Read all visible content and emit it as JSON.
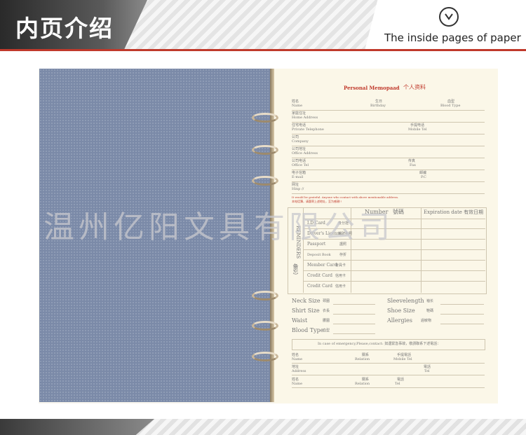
{
  "header": {
    "title_cn": "内页介绍",
    "title_en": "The inside pages of paper",
    "icon": "chevron-down-circle-icon"
  },
  "page": {
    "heading_en": "Personal Memopaad",
    "heading_cn": "个人资料",
    "row1": {
      "name_cn": "姓名",
      "name": "Name",
      "birthday_cn": "生日",
      "birthday": "Birthday",
      "blood_cn": "血型",
      "blood": "Blood Type"
    },
    "home_cn": "家庭住址",
    "home": "Home Address",
    "tel_cn": "住宅电话",
    "tel": "Private Telephone",
    "mobile_cn": "手提电话",
    "mobile": "Mobile Tel",
    "company_cn": "公司",
    "company": "Company",
    "office_addr_cn": "公司地址",
    "office_addr": "Office Address",
    "office_tel_cn": "公司电话",
    "office_tel": "Office Tel",
    "fax_cn": "传真",
    "fax": "Fax",
    "email_cn": "电子信箱",
    "email": "E-mail",
    "pc_cn": "邮编",
    "pc": "P.C",
    "hinp_cn": "网址",
    "hinp": "Hinp //",
    "notice_en": "It would be grateful. Anyone who contact with above mentionable address.",
    "notice_cn": "本电话簿，请惠寄上述地址，至为感谢!!",
    "reminders": {
      "number_header": "Number",
      "number_cn": "號碼",
      "expiration_header": "Expiration date 有效日期",
      "side_label": "REMINDERS",
      "side_cn": "备忘",
      "rows": [
        {
          "en": "I.D Card",
          "cn": "身分證"
        },
        {
          "en": "Driver's License",
          "cn": "驾驶执照"
        },
        {
          "en": "Passport",
          "cn": "護照"
        },
        {
          "en": "Deposit Book",
          "cn": "存折"
        },
        {
          "en": "Member Card",
          "cn": "會員卡"
        },
        {
          "en": "Credit Card",
          "cn": "信用卡"
        },
        {
          "en": "Credit Card",
          "cn": "信用卡"
        }
      ]
    },
    "sizes": {
      "neck": "Neck Size",
      "neck_cn": "颈圍",
      "shirt": "Shirt Size",
      "shirt_cn": "衣長",
      "waist": "Waist",
      "waist_cn": "腰圍",
      "blood": "Blood Type",
      "blood_cn": "血型",
      "sleeve": "Sleevelength",
      "sleeve_cn": "袖长",
      "shoe": "Shoe Size",
      "shoe_cn": "鞋碼",
      "allergies": "Allergies",
      "allergies_cn": "過敏物"
    },
    "emergency": "In case of emergency,Please,contact: 如遇緊急事故，敬請聯系下述電話：",
    "em_rows": {
      "name_cn": "姓名",
      "name": "Name",
      "relation_cn": "關系",
      "relation": "Relation",
      "mobile_cn": "手提電話",
      "mobile": "Mobile Tel",
      "tel_cn": "電話",
      "tel": "Tel",
      "address_cn": "地址",
      "address": "Address"
    }
  },
  "watermark": "温州亿阳文具有限公司",
  "colors": {
    "accent": "#c0392b",
    "cover": "#7b8aa8",
    "paper": "#fbf7e8"
  }
}
